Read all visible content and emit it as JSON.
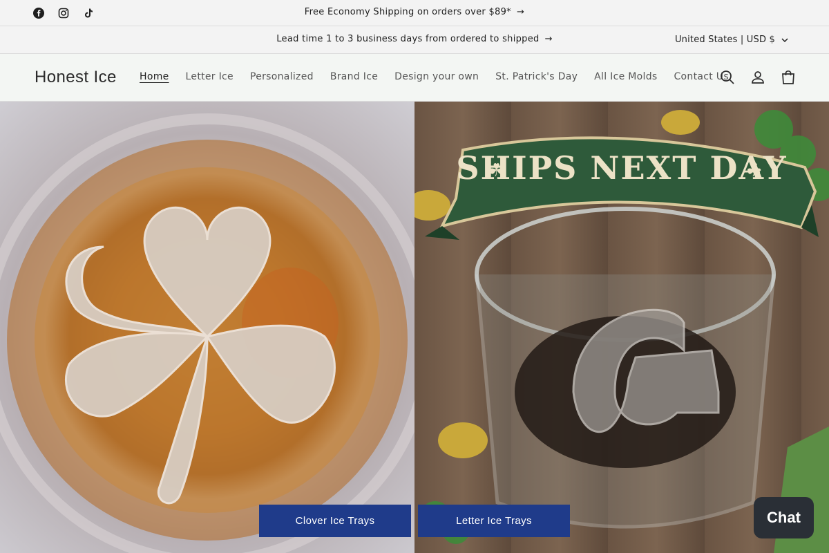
{
  "announcement": {
    "text1": "Free Economy Shipping on orders over $89*",
    "text2": "Lead time 1 to 3 business days from ordered to shipped",
    "currency": "United States | USD $"
  },
  "social": [
    "facebook-icon",
    "instagram-icon",
    "tiktok-icon"
  ],
  "header": {
    "logo": "Honest Ice",
    "nav": [
      "Home",
      "Letter Ice",
      "Personalized",
      "Brand Ice",
      "Design your own",
      "St. Patrick's Day",
      "All Ice Molds",
      "Contact Us"
    ],
    "active_nav": "Home",
    "icons": [
      "search-icon",
      "account-icon",
      "cart-icon"
    ]
  },
  "hero": {
    "left_button": "Clover Ice Trays",
    "right_button": "Letter Ice Trays",
    "banner_text": "SHIPS NEXT DAY"
  },
  "chat": {
    "label": "Chat"
  },
  "colors": {
    "button": "#1f3b8a",
    "banner": "#2e5a3a",
    "chat": "#2a2f36"
  }
}
